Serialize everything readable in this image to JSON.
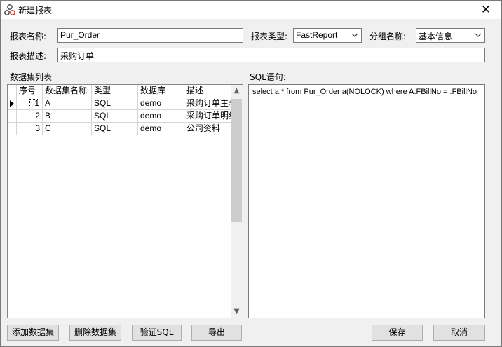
{
  "window": {
    "title": "新建报表",
    "close_label": "✕"
  },
  "form": {
    "report_name_label": "报表名称:",
    "report_name_value": "Pur_Order",
    "report_type_label": "报表类型:",
    "report_type_value": "FastReport",
    "group_name_label": "分组名称:",
    "group_name_value": "基本信息",
    "report_desc_label": "报表描述:",
    "report_desc_value": "采购订单"
  },
  "dataset_list": {
    "label": "数据集列表",
    "columns": [
      "序号",
      "数据集名称",
      "类型",
      "数据库",
      "描述"
    ],
    "rows": [
      {
        "no": "1",
        "name": "A",
        "type": "SQL",
        "db": "demo",
        "desc": "采购订单主表"
      },
      {
        "no": "2",
        "name": "B",
        "type": "SQL",
        "db": "demo",
        "desc": "采购订单明细"
      },
      {
        "no": "3",
        "name": "C",
        "type": "SQL",
        "db": "demo",
        "desc": "公司资料"
      }
    ]
  },
  "sql": {
    "label": "SQL语句:",
    "text": "select a.* from Pur_Order a(NOLOCK) where A.FBillNo = :FBillNo"
  },
  "buttons": {
    "add_dataset": "添加数据集",
    "delete_dataset": "删除数据集",
    "validate_sql": "验证SQL",
    "export": "导出",
    "save": "保存",
    "cancel": "取消"
  }
}
